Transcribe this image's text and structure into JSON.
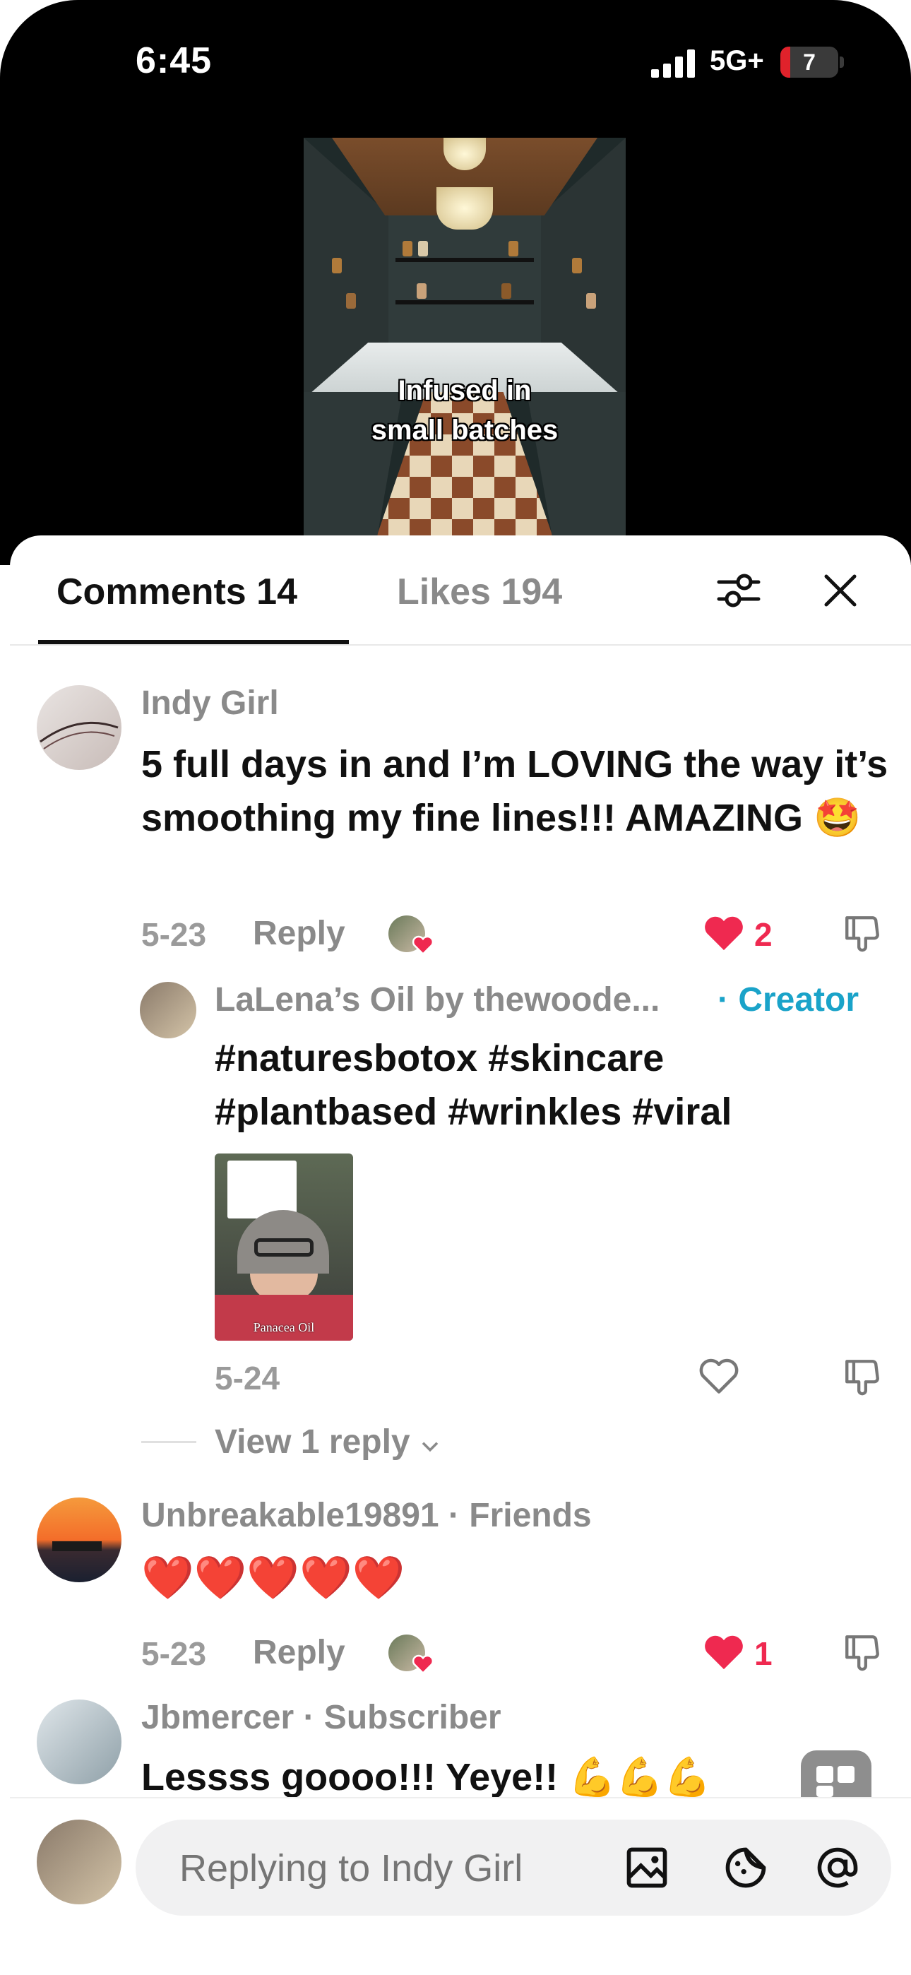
{
  "status_bar": {
    "time": "6:45",
    "network": "5G+",
    "battery": "7"
  },
  "video": {
    "caption_line1": "Infused in",
    "caption_line2": "small batches"
  },
  "tabs": {
    "comments": "Comments 14",
    "likes": "Likes 194"
  },
  "comments": [
    {
      "username": "Indy Girl",
      "text": "5 full days in and I’m LOVING the way it’s smoothing my fine lines!!! AMAZING 🤩",
      "date": "5-23",
      "reply_label": "Reply",
      "likes": "2",
      "replies": [
        {
          "username": "LaLena’s Oil by thewoode...",
          "badge": "· Creator",
          "text": "#naturesbotox #skincare #plantbased #wrinkles #viral",
          "date": "5-24",
          "video_label": "Panacea Oil"
        }
      ],
      "view_replies": "View 1 reply"
    },
    {
      "username": "Unbreakable19891 · Friends",
      "text": "❤️❤️❤️❤️❤️",
      "date": "5-23",
      "reply_label": "Reply",
      "likes": "1"
    },
    {
      "username": "Jbmercer · Subscriber",
      "text": "Lessss goooo!!! Yeye!! 💪💪💪"
    }
  ],
  "input": {
    "placeholder": "Replying to Indy Girl"
  },
  "icons": [
    "filter-icon",
    "close-icon",
    "heart-icon",
    "dislike-icon",
    "image-icon",
    "emoji-icon",
    "mention-icon",
    "chat-bubble-icon"
  ],
  "colors": {
    "like": "#ef2950",
    "creator": "#1aa3c9"
  }
}
